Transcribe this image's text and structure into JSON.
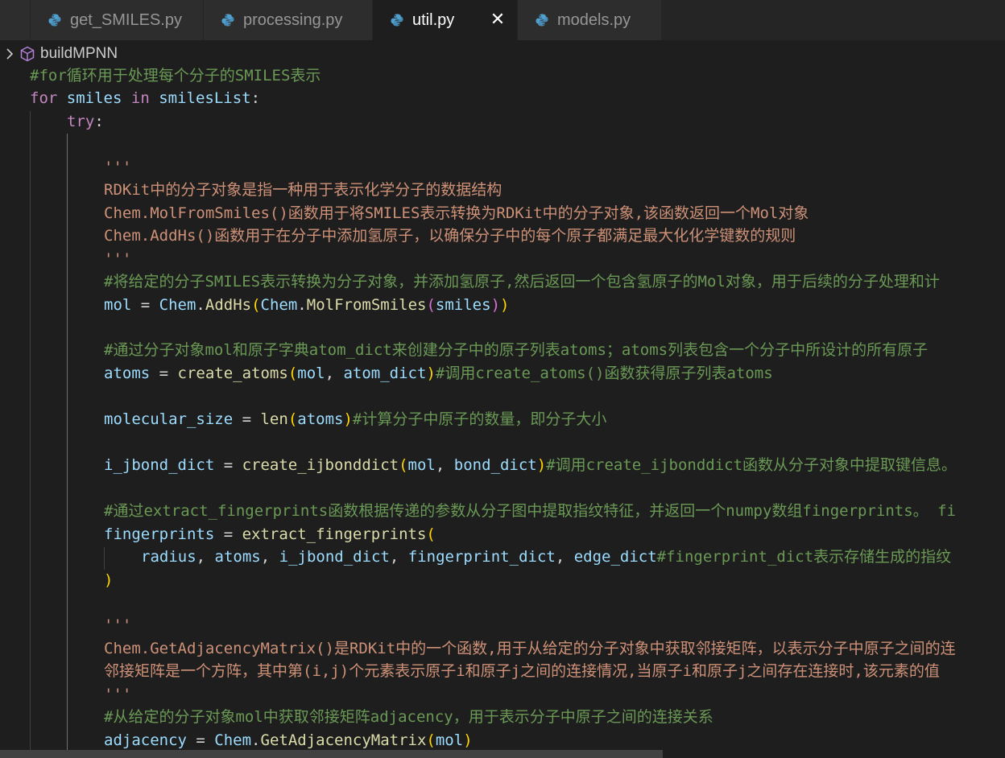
{
  "tabs": [
    {
      "label": "get_SMILES.py"
    },
    {
      "label": "processing.py"
    },
    {
      "label": "util.py"
    },
    {
      "label": "models.py"
    }
  ],
  "close_glyph": "✕",
  "breadcrumb": {
    "symbol": "buildMPNN"
  },
  "colors": {
    "keyword_blue": "#569cd6",
    "control_purple": "#c586c0",
    "variable": "#9cdcfe",
    "function": "#dcdcaa",
    "comment": "#6a9955",
    "string": "#ce9178",
    "python_icon": "#4f9fcf"
  },
  "code": {
    "l01": "#for循环用于处理每个分子的SMILES表示",
    "l02": {
      "for": "for",
      "var": "smiles",
      "in": "in",
      "list": "smilesList",
      "colon": ":"
    },
    "l03": {
      "try": "try",
      "colon": ":"
    },
    "l05": "'''",
    "l06": "RDKit中的分子对象是指一种用于表示化学分子的数据结构",
    "l07": "Chem.MolFromSmiles()函数用于将SMILES表示转换为RDKit中的分子对象,该函数返回一个Mol对象",
    "l08": "Chem.AddHs()函数用于在分子中添加氢原子，以确保分子中的每个原子都满足最大化化学键数的规则",
    "l09": "'''",
    "l10": "#将给定的分子SMILES表示转换为分子对象，并添加氢原子,然后返回一个包含氢原子的Mol对象，用于后续的分子处理和计",
    "l11": {
      "mol": "mol",
      "eq": " = ",
      "chem1": "Chem",
      "addhs": "AddHs",
      "chem2": "Chem",
      "mfs": "MolFromSmiles",
      "arg": "smiles"
    },
    "l13": "#通过分子对象mol和原子字典atom_dict来创建分子中的原子列表atoms；atoms列表包含一个分子中所设计的所有原子",
    "l14": {
      "atoms": "atoms",
      "eq": " = ",
      "fn": "create_atoms",
      "a1": "mol",
      "a2": "atom_dict",
      "cm": "#调用create_atoms()函数获得原子列表atoms"
    },
    "l16": {
      "var": "molecular_size",
      "eq": " = ",
      "fn": "len",
      "arg": "atoms",
      "cm": "#计算分子中原子的数量，即分子大小"
    },
    "l18": {
      "var": "i_jbond_dict",
      "eq": " = ",
      "fn": "create_ijbonddict",
      "a1": "mol",
      "a2": "bond_dict",
      "cm": "#调用create_ijbonddict函数从分子对象中提取键信息。"
    },
    "l20": "#通过extract_fingerprints函数根据传递的参数从分子图中提取指纹特征，并返回一个numpy数组fingerprints。 fi",
    "l21": {
      "var": "fingerprints",
      "eq": " = ",
      "fn": "extract_fingerprints"
    },
    "l22": {
      "a1": "radius",
      "a2": "atoms",
      "a3": "i_jbond_dict",
      "a4": "fingerprint_dict",
      "a5": "edge_dict",
      "cm": "#fingerprint_dict表示存储生成的指纹"
    },
    "l23": ")",
    "l25": "'''",
    "l26": "Chem.GetAdjacencyMatrix()是RDKit中的一个函数,用于从给定的分子对象中获取邻接矩阵，以表示分子中原子之间的连",
    "l27": "邻接矩阵是一个方阵，其中第(i,j)个元素表示原子i和原子j之间的连接情况,当原子i和原子j之间存在连接时,该元素的值",
    "l28": "'''",
    "l29": "#从给定的分子对象mol中获取邻接矩阵adjacency，用于表示分子中原子之间的连接关系",
    "l30": {
      "var": "adjacency",
      "eq": " = ",
      "chem": "Chem",
      "fn": "GetAdjacencyMatrix",
      "arg": "mol"
    }
  }
}
